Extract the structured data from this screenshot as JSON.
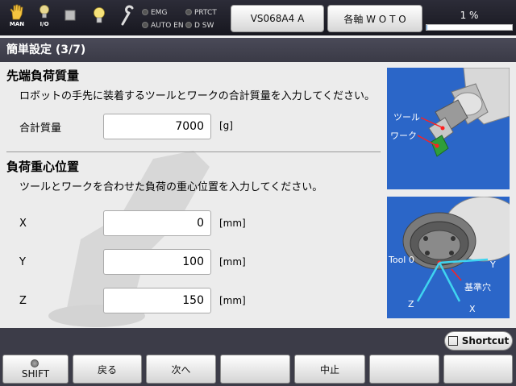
{
  "topbar": {
    "mode_icon_label": "MAN",
    "io_icon_label": "I/O",
    "indicators": {
      "emg": "EMG",
      "prtct": "PRTCT",
      "auto_en": "AUTO EN",
      "d_sw": "D SW"
    },
    "robot_button": "VS068A4 A",
    "coord_button": "各軸  W O T O",
    "speed_text": "1 %",
    "speed_value": 0.01
  },
  "title": "簡単設定 (3/7)",
  "section1": {
    "title": "先端負荷質量",
    "desc": "ロボットの手先に装着するツールとワークの合計質量を入力してください。",
    "mass_label": "合計質量",
    "mass_value": "7000",
    "mass_unit": "[g]"
  },
  "section2": {
    "title": "負荷重心位置",
    "desc": "ツールとワークを合わせた負荷の重心位置を入力してください。",
    "fields": [
      {
        "label": "X",
        "value": "0",
        "unit": "[mm]"
      },
      {
        "label": "Y",
        "value": "100",
        "unit": "[mm]"
      },
      {
        "label": "Z",
        "value": "150",
        "unit": "[mm]"
      }
    ]
  },
  "image1": {
    "tool_label": "ツール",
    "work_label": "ワーク"
  },
  "image2": {
    "tool0_label": "Tool 0",
    "y_label": "Y",
    "z_label": "Z",
    "x_label": "X",
    "ref_hole_label": "基準穴"
  },
  "shortcut_label": "Shortcut",
  "fkeys": [
    "SHIFT",
    "戻る",
    "次へ",
    "",
    "中止",
    "",
    ""
  ],
  "colors": {
    "accent": "#2b66c8",
    "axis": "#3fd4f0"
  }
}
